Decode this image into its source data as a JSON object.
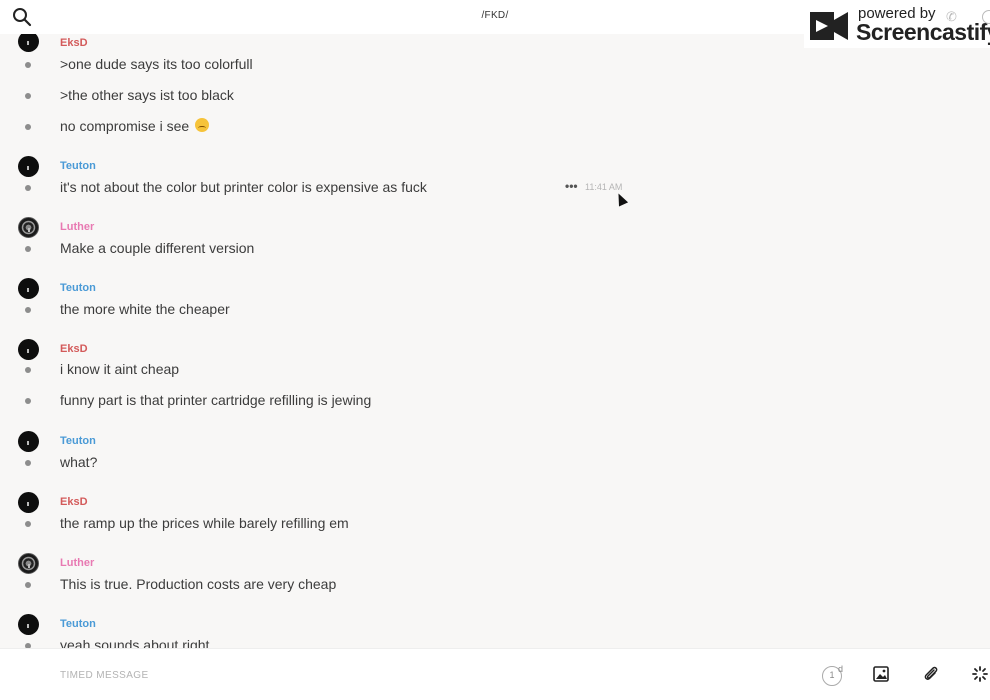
{
  "header": {
    "title": "/FKD/"
  },
  "watermark": {
    "powered_by": "powered by",
    "brand": "Screencastify"
  },
  "messages": [
    {
      "user": "EksD",
      "user_color": "#d35a5a",
      "lines": [
        "&gt;one dude says its too colorfull",
        "&gt;the other says ist too black",
        "no compromise i see"
      ]
    },
    {
      "user": "Teuton",
      "user_color": "#4a9ad6",
      "lines": [
        "it's not about the color but printer color is expensive as fuck"
      ],
      "hover_time": "11:41 AM"
    },
    {
      "user": "Luther",
      "user_color": "#e879b2",
      "lines": [
        "Make a couple different version"
      ]
    },
    {
      "user": "Teuton",
      "user_color": "#4a9ad6",
      "lines": [
        "the more white the cheaper"
      ]
    },
    {
      "user": "EksD",
      "user_color": "#d35a5a",
      "lines": [
        "i know it aint cheap",
        "funny part is that printer cartridge refilling is jewing"
      ]
    },
    {
      "user": "Teuton",
      "user_color": "#4a9ad6",
      "lines": [
        "what?"
      ]
    },
    {
      "user": "EksD",
      "user_color": "#d35a5a",
      "lines": [
        "the ramp up the prices while barely refilling em"
      ]
    },
    {
      "user": "Luther",
      "user_color": "#e879b2",
      "lines": [
        "This is true. Production costs are very cheap"
      ]
    },
    {
      "user": "Teuton",
      "user_color": "#4a9ad6",
      "lines": [
        "yeah sounds about right"
      ]
    }
  ],
  "message_actions_icon": "more-options-icon",
  "composer": {
    "placeholder": "TIMED MESSAGE",
    "timer_value": "1",
    "timer_unit": "d"
  }
}
